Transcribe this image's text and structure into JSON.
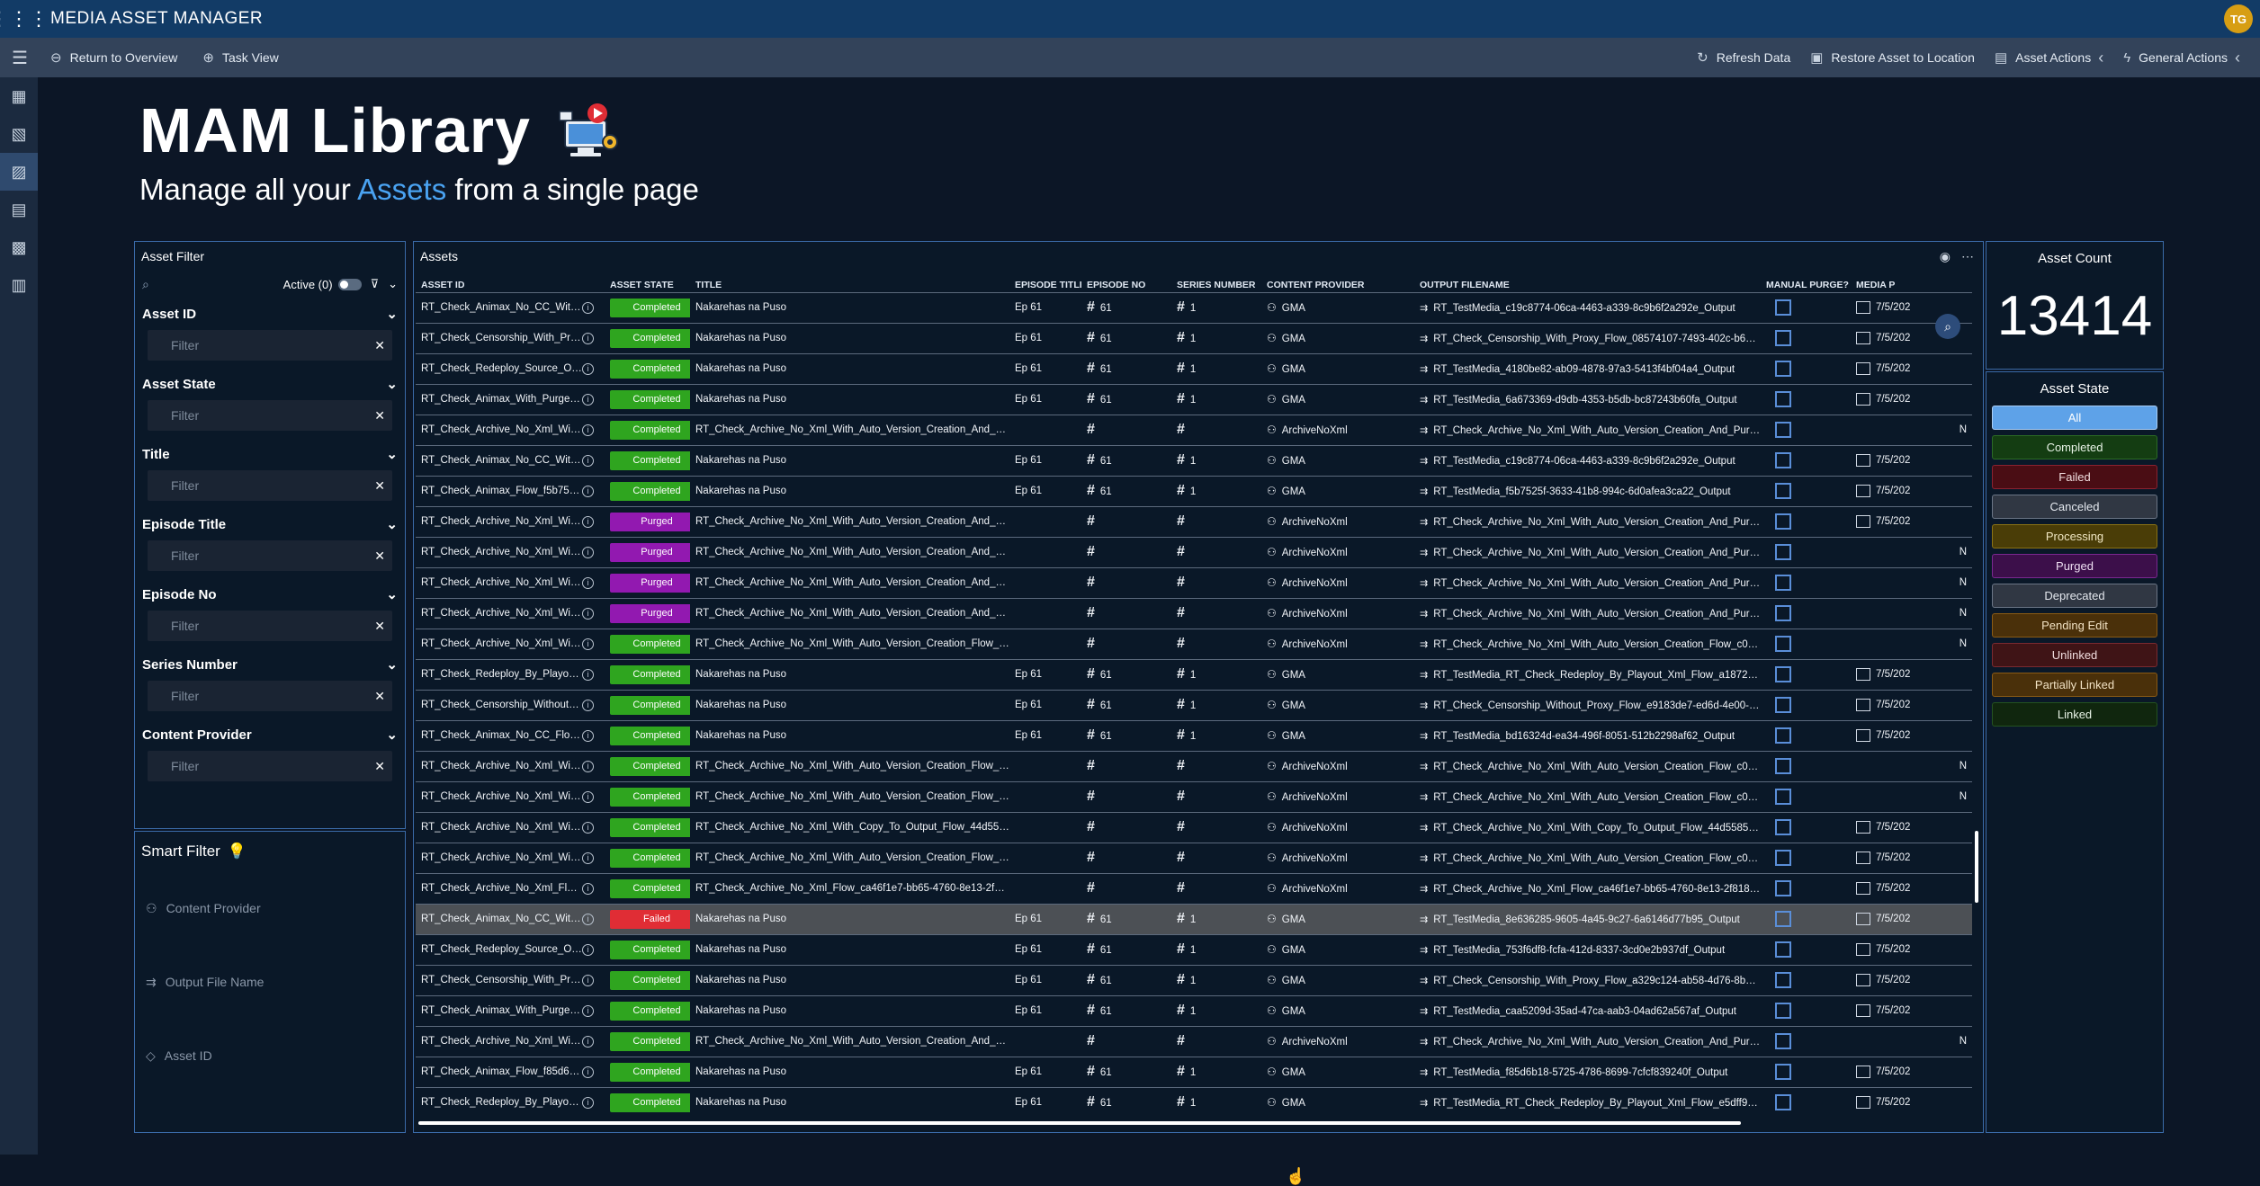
{
  "app": {
    "title": "MEDIA ASSET MANAGER",
    "avatar": "TG"
  },
  "commands": {
    "return": "Return to Overview",
    "task": "Task View",
    "refresh": "Refresh Data",
    "restore": "Restore Asset to Location",
    "asset_actions": "Asset Actions",
    "general_actions": "General Actions"
  },
  "hero": {
    "title": "MAM Library",
    "sub_pre": "Manage all your ",
    "sub_hl": "Assets",
    "sub_post": " from a single page"
  },
  "filter": {
    "title": "Asset Filter",
    "active": "Active (0)",
    "placeholder": "Filter",
    "groups": [
      "Asset ID",
      "Asset State",
      "Title",
      "Episode Title",
      "Episode No",
      "Series Number",
      "Content Provider"
    ]
  },
  "smart": {
    "title": "Smart Filter",
    "items": [
      "Content Provider",
      "Output File Name",
      "Asset ID"
    ]
  },
  "assets": {
    "title": "Assets",
    "columns": [
      "ASSET ID",
      "ASSET STATE",
      "TITLE",
      "EPISODE TITLE",
      "EPISODE NO",
      "SERIES NUMBER",
      "CONTENT PROVIDER",
      "OUTPUT FILENAME",
      "MANUAL PURGE?",
      "MEDIA P"
    ],
    "rows": [
      [
        "RT_Check_Animax_No_CC_With_Auto_Ve...",
        "Completed",
        "Nakarehas na Puso",
        "Ep 61",
        "61",
        "1",
        "GMA",
        "RT_TestMedia_c19c8774-06ca-4463-a339-8c9b6f2a292e_Output",
        "7/5/202"
      ],
      [
        "RT_Check_Censorship_With_Proxy_Flow_...",
        "Completed",
        "Nakarehas na Puso",
        "Ep 61",
        "61",
        "1",
        "GMA",
        "RT_Check_Censorship_With_Proxy_Flow_08574107-7493-402c-b62b-8...",
        "7/5/202"
      ],
      [
        "RT_Check_Redeploy_Source_On_New_Se...",
        "Completed",
        "Nakarehas na Puso",
        "Ep 61",
        "61",
        "1",
        "GMA",
        "RT_TestMedia_4180be82-ab09-4878-97a3-5413f4bf04a4_Output",
        "7/5/202"
      ],
      [
        "RT_Check_Animax_With_Purge_Flow_6a6...",
        "Completed",
        "Nakarehas na Puso",
        "Ep 61",
        "61",
        "1",
        "GMA",
        "RT_TestMedia_6a673369-d9db-4353-b5db-bc87243b60fa_Output",
        "7/5/202"
      ],
      [
        "RT_Check_Archive_No_Xml_With_Auto_V...",
        "Completed",
        "RT_Check_Archive_No_Xml_With_Auto_Version_Creation_And_Purge_Fl...",
        "",
        "",
        "",
        "ArchiveNoXml",
        "RT_Check_Archive_No_Xml_With_Auto_Version_Creation_And_Purge_...",
        "N"
      ],
      [
        "RT_Check_Animax_No_CC_With_Auto_Ve...",
        "Completed",
        "Nakarehas na Puso",
        "Ep 61",
        "61",
        "1",
        "GMA",
        "RT_TestMedia_c19c8774-06ca-4463-a339-8c9b6f2a292e_Output",
        "7/5/202"
      ],
      [
        "RT_Check_Animax_Flow_f5b7525f-3633-...",
        "Completed",
        "Nakarehas na Puso",
        "Ep 61",
        "61",
        "1",
        "GMA",
        "RT_TestMedia_f5b7525f-3633-41b8-994c-6d0afea3ca22_Output",
        "7/5/202"
      ],
      [
        "RT_Check_Archive_No_Xml_With_Auto_V...",
        "Purged",
        "RT_Check_Archive_No_Xml_With_Auto_Version_Creation_And_Purge_Fl...",
        "",
        "",
        "",
        "ArchiveNoXml",
        "RT_Check_Archive_No_Xml_With_Auto_Version_Creation_And_Purge_...",
        "7/5/202"
      ],
      [
        "RT_Check_Archive_No_Xml_With_Auto_V...",
        "Purged",
        "RT_Check_Archive_No_Xml_With_Auto_Version_Creation_And_Purge_Fl...",
        "",
        "",
        "",
        "ArchiveNoXml",
        "RT_Check_Archive_No_Xml_With_Auto_Version_Creation_And_Purge_...",
        "N"
      ],
      [
        "RT_Check_Archive_No_Xml_With_Auto_V...",
        "Purged",
        "RT_Check_Archive_No_Xml_With_Auto_Version_Creation_And_Purge_Fl...",
        "",
        "",
        "",
        "ArchiveNoXml",
        "RT_Check_Archive_No_Xml_With_Auto_Version_Creation_And_Purge_...",
        "N"
      ],
      [
        "RT_Check_Archive_No_Xml_With_Auto_V...",
        "Purged",
        "RT_Check_Archive_No_Xml_With_Auto_Version_Creation_And_Purge_Fl...",
        "",
        "",
        "",
        "ArchiveNoXml",
        "RT_Check_Archive_No_Xml_With_Auto_Version_Creation_And_Purge_...",
        "N"
      ],
      [
        "RT_Check_Archive_No_Xml_With_Auto_V...",
        "Completed",
        "RT_Check_Archive_No_Xml_With_Auto_Version_Creation_Flow_c08998...",
        "",
        "",
        "",
        "ArchiveNoXml",
        "RT_Check_Archive_No_Xml_With_Auto_Version_Creation_Flow_c08998...",
        "N"
      ],
      [
        "RT_Check_Redeploy_By_Playout_Xml_Flo...",
        "Completed",
        "Nakarehas na Puso",
        "Ep 61",
        "61",
        "1",
        "GMA",
        "RT_TestMedia_RT_Check_Redeploy_By_Playout_Xml_Flow_a1872ecc-5...",
        "7/5/202"
      ],
      [
        "RT_Check_Censorship_Without_Proxy_Flo...",
        "Completed",
        "Nakarehas na Puso",
        "Ep 61",
        "61",
        "1",
        "GMA",
        "RT_Check_Censorship_Without_Proxy_Flow_e9183de7-ed6d-4e00-a5f...",
        "7/5/202"
      ],
      [
        "RT_Check_Animax_No_CC_Flow_bd16324...",
        "Completed",
        "Nakarehas na Puso",
        "Ep 61",
        "61",
        "1",
        "GMA",
        "RT_TestMedia_bd16324d-ea34-496f-8051-512b2298af62_Output",
        "7/5/202"
      ],
      [
        "RT_Check_Archive_No_Xml_With_Auto_V...",
        "Completed",
        "RT_Check_Archive_No_Xml_With_Auto_Version_Creation_Flow_c08998...",
        "",
        "",
        "",
        "ArchiveNoXml",
        "RT_Check_Archive_No_Xml_With_Auto_Version_Creation_Flow_c08998...",
        "N"
      ],
      [
        "RT_Check_Archive_No_Xml_With_Auto_V...",
        "Completed",
        "RT_Check_Archive_No_Xml_With_Auto_Version_Creation_Flow_c08998...",
        "",
        "",
        "",
        "ArchiveNoXml",
        "RT_Check_Archive_No_Xml_With_Auto_Version_Creation_Flow_c08998...",
        "N"
      ],
      [
        "RT_Check_Archive_No_Xml_With_Copy_T...",
        "Completed",
        "RT_Check_Archive_No_Xml_With_Copy_To_Output_Flow_44d5585c-9d...",
        "",
        "",
        "",
        "ArchiveNoXml",
        "RT_Check_Archive_No_Xml_With_Copy_To_Output_Flow_44d5585c-9d...",
        "7/5/202"
      ],
      [
        "RT_Check_Archive_No_Xml_With_Auto_V...",
        "Completed",
        "RT_Check_Archive_No_Xml_With_Auto_Version_Creation_Flow_c08998...",
        "",
        "",
        "",
        "ArchiveNoXml",
        "RT_Check_Archive_No_Xml_With_Auto_Version_Creation_Flow_c08998...",
        "7/5/202"
      ],
      [
        "RT_Check_Archive_No_Xml_Flow_ca46f1e...",
        "Completed",
        "RT_Check_Archive_No_Xml_Flow_ca46f1e7-bb65-4760-8e13-2f81844e...",
        "",
        "",
        "",
        "ArchiveNoXml",
        "RT_Check_Archive_No_Xml_Flow_ca46f1e7-bb65-4760-8e13-2f81844...",
        "7/5/202"
      ],
      [
        "RT_Check_Animax_No_CC_With_Auto_Ve...",
        "Failed",
        "Nakarehas na Puso",
        "Ep 61",
        "61",
        "1",
        "GMA",
        "RT_TestMedia_8e636285-9605-4a45-9c27-6a6146d77b95_Output",
        "7/5/202"
      ],
      [
        "RT_Check_Redeploy_Source_On_New_Se...",
        "Completed",
        "Nakarehas na Puso",
        "Ep 61",
        "61",
        "1",
        "GMA",
        "RT_TestMedia_753f6df8-fcfa-412d-8337-3cd0e2b937df_Output",
        "7/5/202"
      ],
      [
        "RT_Check_Censorship_With_Proxy_Flow_...",
        "Completed",
        "Nakarehas na Puso",
        "Ep 61",
        "61",
        "1",
        "GMA",
        "RT_Check_Censorship_With_Proxy_Flow_a329c124-ab58-4d76-8b72-c...",
        "7/5/202"
      ],
      [
        "RT_Check_Animax_With_Purge_Flow_caa...",
        "Completed",
        "Nakarehas na Puso",
        "Ep 61",
        "61",
        "1",
        "GMA",
        "RT_TestMedia_caa5209d-35ad-47ca-aab3-04ad62a567af_Output",
        "7/5/202"
      ],
      [
        "RT_Check_Archive_No_Xml_With_Auto_V...",
        "Completed",
        "RT_Check_Archive_No_Xml_With_Auto_Version_Creation_And_Purge_Fl...",
        "",
        "",
        "",
        "ArchiveNoXml",
        "RT_Check_Archive_No_Xml_With_Auto_Version_Creation_And_Purge_...",
        "N"
      ],
      [
        "RT_Check_Animax_Flow_f85d6b18-5725-...",
        "Completed",
        "Nakarehas na Puso",
        "Ep 61",
        "61",
        "1",
        "GMA",
        "RT_TestMedia_f85d6b18-5725-4786-8699-7cfcf839240f_Output",
        "7/5/202"
      ],
      [
        "RT_Check_Redeploy_By_Playout_Xml_Flo...",
        "Completed",
        "Nakarehas na Puso",
        "Ep 61",
        "61",
        "1",
        "GMA",
        "RT_TestMedia_RT_Check_Redeploy_By_Playout_Xml_Flow_e5dff922-b...",
        "7/5/202"
      ]
    ]
  },
  "count": {
    "title": "Asset Count",
    "value": "13414"
  },
  "states": {
    "title": "Asset State",
    "items": [
      {
        "label": "All",
        "bg": "#5ea2e8",
        "fg": "#ffffff",
        "border": "#a9cdf5"
      },
      {
        "label": "Completed",
        "bg": "#143d12",
        "fg": "#e8f3e6",
        "border": "#2b6a25"
      },
      {
        "label": "Failed",
        "bg": "#4a0d14",
        "fg": "#f2dfe0",
        "border": "#8a2230"
      },
      {
        "label": "Canceled",
        "bg": "#303743",
        "fg": "#e4e8ee",
        "border": "#6a7585"
      },
      {
        "label": "Processing",
        "bg": "#4a3d07",
        "fg": "#f0e6c2",
        "border": "#8a7214"
      },
      {
        "label": "Purged",
        "bg": "#3c0f4a",
        "fg": "#eedff2",
        "border": "#7a2890"
      },
      {
        "label": "Deprecated",
        "bg": "#303743",
        "fg": "#e4e8ee",
        "border": "#6a7585"
      },
      {
        "label": "Pending Edit",
        "bg": "#4a300a",
        "fg": "#f2e2c4",
        "border": "#8a5a14"
      },
      {
        "label": "Unlinked",
        "bg": "#3f1416",
        "fg": "#f2dfe0",
        "border": "#7a2a30"
      },
      {
        "label": "Partially Linked",
        "bg": "#4a300a",
        "fg": "#f2e2c4",
        "border": "#8a5a14"
      },
      {
        "label": "Linked",
        "bg": "#10260e",
        "fg": "#e8f3e6",
        "border": "#245220"
      }
    ]
  }
}
